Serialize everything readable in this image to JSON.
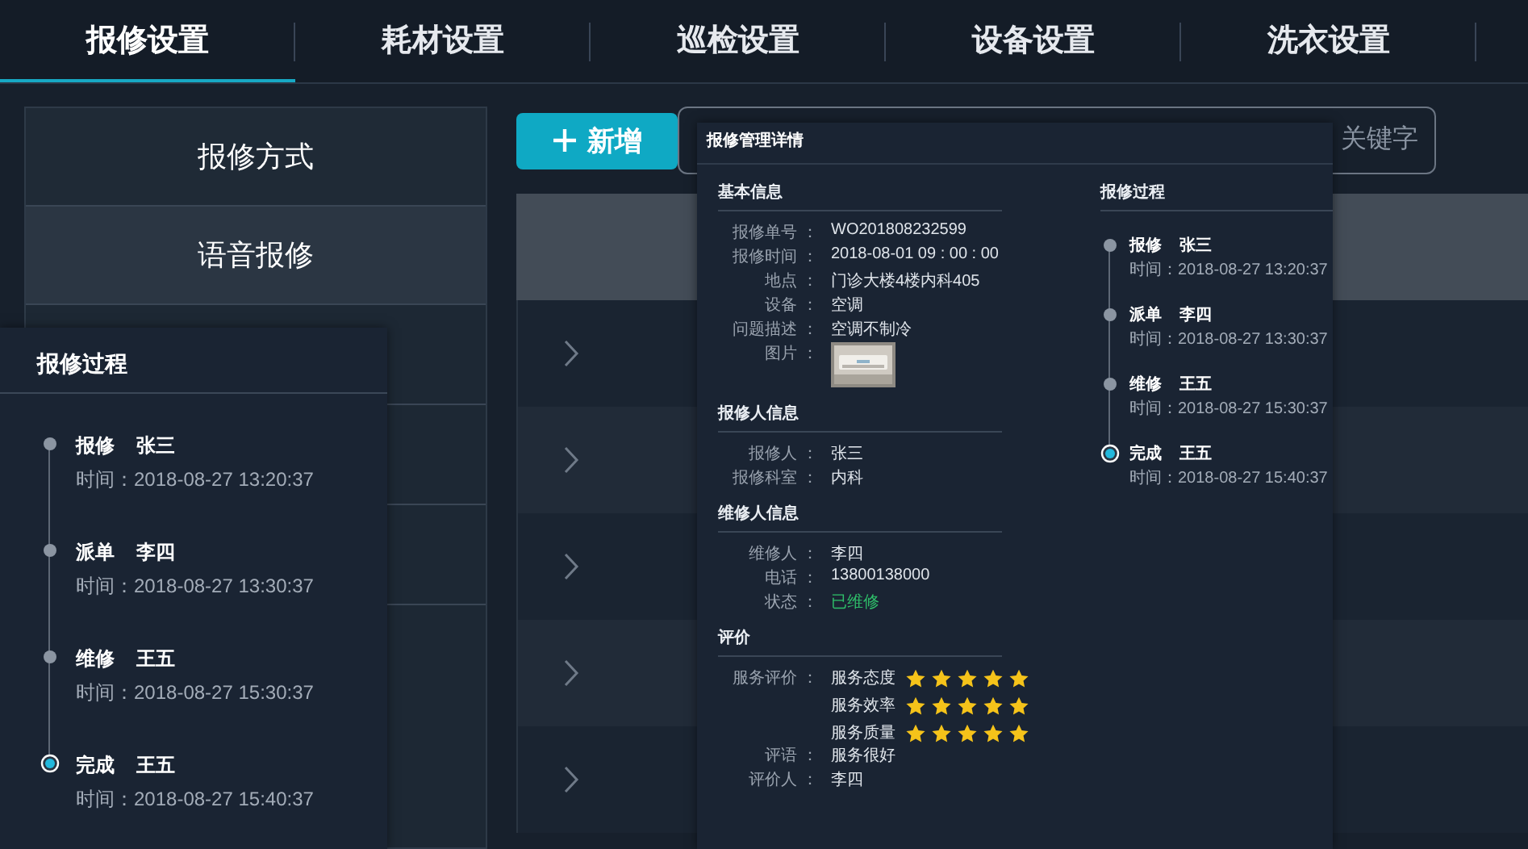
{
  "tabs": [
    {
      "label": "报修设置",
      "selected": true
    },
    {
      "label": "耗材设置",
      "selected": false
    },
    {
      "label": "巡检设置",
      "selected": false
    },
    {
      "label": "设备设置",
      "selected": false
    },
    {
      "label": "洗衣设置",
      "selected": false
    }
  ],
  "sidebar": {
    "items": [
      {
        "label": "报修方式",
        "selected": false
      },
      {
        "label": "语音报修",
        "selected": true
      }
    ]
  },
  "toolbar": {
    "add_button": "新增",
    "search": {
      "placeholder": "关键字"
    }
  },
  "table": {
    "rows": [
      {
        "expanded": false
      },
      {
        "expanded": false
      },
      {
        "expanded": false
      },
      {
        "expanded": false
      },
      {
        "expanded": false
      }
    ]
  },
  "process_panel": {
    "title": "报修过程",
    "steps": [
      {
        "action": "报修",
        "person": "张三",
        "time": "时间：2018-08-27 13:20:37",
        "current": false
      },
      {
        "action": "派单",
        "person": "李四",
        "time": "时间：2018-08-27 13:30:37",
        "current": false
      },
      {
        "action": "维修",
        "person": "王五",
        "time": "时间：2018-08-27 15:30:37",
        "current": false
      },
      {
        "action": "完成",
        "person": "王五",
        "time": "时间：2018-08-27 15:40:37",
        "current": true
      }
    ]
  },
  "detail": {
    "title": "报修管理详情",
    "sections": [
      {
        "title": "基本信息",
        "fields": [
          {
            "kind": "text",
            "label": "报修单号 ：",
            "value": "WO201808232599"
          },
          {
            "kind": "text",
            "label": "报修时间 ：",
            "value": "2018-08-01  09 : 00 : 00"
          },
          {
            "kind": "text",
            "label": "地点 ：",
            "value": "门诊大楼4楼内科405"
          },
          {
            "kind": "text",
            "label": "设备 ：",
            "value": "空调"
          },
          {
            "kind": "text",
            "label": "问题描述 ：",
            "value": "空调不制冷"
          },
          {
            "kind": "picture",
            "label": "图片 ："
          }
        ]
      },
      {
        "title": "报修人信息",
        "fields": [
          {
            "kind": "text",
            "label": "报修人 ：",
            "value": "张三"
          },
          {
            "kind": "text",
            "label": "报修科室 ：",
            "value": "内科"
          }
        ]
      },
      {
        "title": "维修人信息",
        "fields": [
          {
            "kind": "text",
            "label": "维修人 ：",
            "value": "李四"
          },
          {
            "kind": "text",
            "label": "电话 ：",
            "value": "13800138000"
          },
          {
            "kind": "status",
            "label": "状态 ：",
            "value": "已维修"
          }
        ]
      },
      {
        "title": "评价",
        "fields": [
          {
            "kind": "rating",
            "label": "服务评价 ：",
            "items": [
              {
                "name": "服务态度",
                "stars": 5
              },
              {
                "name": "服务效率",
                "stars": 5
              },
              {
                "name": "服务质量",
                "stars": 5
              }
            ]
          },
          {
            "kind": "text",
            "label": "评语 ：",
            "value": "服务很好"
          },
          {
            "kind": "text",
            "label": "评价人 ：",
            "value": "李四"
          }
        ]
      }
    ],
    "timeline": {
      "title": "报修过程",
      "steps": [
        {
          "action": "报修",
          "person": "张三",
          "time": "时间：2018-08-27 13:20:37",
          "current": false
        },
        {
          "action": "派单",
          "person": "李四",
          "time": "时间：2018-08-27 13:30:37",
          "current": false
        },
        {
          "action": "维修",
          "person": "王五",
          "time": "时间：2018-08-27 15:30:37",
          "current": false
        },
        {
          "action": "完成",
          "person": "王五",
          "time": "时间：2018-08-27 15:40:37",
          "current": true
        }
      ]
    }
  }
}
